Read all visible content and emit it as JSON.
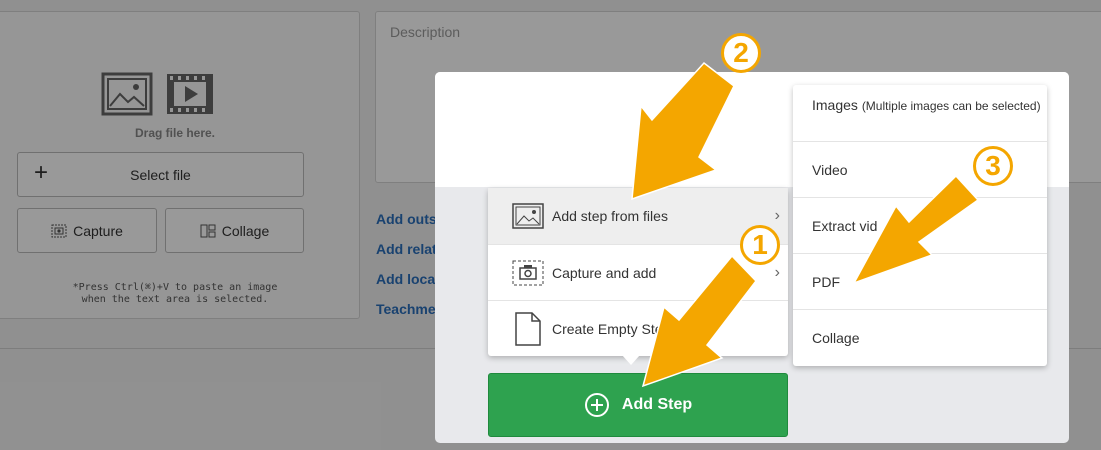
{
  "upload": {
    "drag_text": "Drag file here.",
    "select_file_label": "Select file",
    "capture_label": "Capture",
    "collage_label": "Collage",
    "paste_note_line1": "*Press Ctrl(⌘)+V to paste an image",
    "paste_note_line2": "when the text area is selected."
  },
  "description": {
    "label": "Description"
  },
  "side_links": [
    "Add outside link",
    "Add related manu",
    "Add location data",
    "Teachme Player S"
  ],
  "step_menu": {
    "items": [
      {
        "label": "Add step from files",
        "icon": "image-file-icon",
        "has_submenu": true
      },
      {
        "label": "Capture and add",
        "icon": "camera-icon",
        "has_submenu": true
      },
      {
        "label": "Create Empty Ste",
        "icon": "blank-page-icon",
        "has_submenu": false
      }
    ]
  },
  "file_submenu": {
    "images_label": "Images",
    "images_hint": "(Multiple images can be selected)",
    "items": [
      "Video",
      "Extract vid",
      "PDF",
      "Collage"
    ]
  },
  "add_step_button": {
    "label": "Add Step",
    "icon": "plus-circle-icon"
  },
  "annotations": {
    "badges": [
      "1",
      "2",
      "3"
    ],
    "arrow_color": "#f4a600"
  },
  "colors": {
    "accent_green": "#2ea24f",
    "link_blue": "#2a6ebb",
    "annotation_orange": "#f4a600"
  }
}
